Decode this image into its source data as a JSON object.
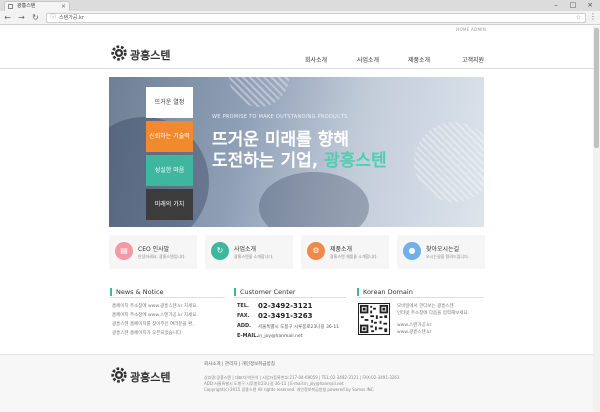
{
  "browser": {
    "tab_title": "광흥스텐",
    "close_glyph": "×",
    "url": "스텐가공.kr",
    "buttons": {
      "minimize": "–",
      "maximize": "□",
      "close": "×",
      "back": "←",
      "forward": "→",
      "reload": "↻",
      "menu": "⋮"
    }
  },
  "header": {
    "top_links": "HOME   ADMIN",
    "logo_text": "광흥스텐",
    "nav": [
      "회사소개",
      "사업소개",
      "제품소개",
      "고객지원"
    ]
  },
  "hero": {
    "subtitle": "WE PROMISE TO MAKE OUTSTANDING PRODUCTS",
    "line1": "뜨거운 미래를 향해",
    "line2_prefix": "도전하는 기업, ",
    "line2_highlight": "광흥스텐",
    "tabs": [
      {
        "label": "뜨거운 열정",
        "bg": "#ffffff",
        "fg": "#333333"
      },
      {
        "label": "신뢰하는 기술력",
        "bg": "#f08a2c",
        "fg": "#ffffff"
      },
      {
        "label": "성실한 마음",
        "bg": "#3fb69e",
        "fg": "#ffffff"
      },
      {
        "label": "미래의 가치",
        "bg": "#3c3c3c",
        "fg": "#ffffff"
      }
    ]
  },
  "features": [
    {
      "title": "CEO 인사말",
      "desc": "안녕하세요, 광흥스텐입니다.",
      "color": "#f29aa6",
      "icon_name": "document-icon",
      "glyph": "▤"
    },
    {
      "title": "사업소개",
      "desc": "광흥스텐을 소개합니다.",
      "color": "#3fb69e",
      "icon_name": "refresh-icon",
      "glyph": "↻"
    },
    {
      "title": "제품소개",
      "desc": "광흥스텐 제품을 소개합니다.",
      "color": "#f0894a",
      "icon_name": "gear-icon",
      "glyph": "⚙"
    },
    {
      "title": "찾아오시는길",
      "desc": "오시는길을 알려드립니다.",
      "color": "#6fb0e8",
      "icon_name": "location-pin-icon",
      "glyph": "●"
    }
  ],
  "news": {
    "title": "News & Notice",
    "items": [
      "홈페이지 주소창에 www.광흥스텐.kr 치세요.",
      "홈페이지 주소창에 www.스텐가공.kr 치세요.",
      "광흥스텐 홈페이지를 찾아주신 여러분을 환..",
      "광흥스텐 홈페이지가 오픈되었습니다."
    ]
  },
  "customer": {
    "title": "Customer Center",
    "rows": [
      {
        "label": "TEL.",
        "value": "02-3492-3121",
        "big": true
      },
      {
        "label": "FAX.",
        "value": "02-3491-3263",
        "big": true
      },
      {
        "label": "ADD.",
        "value": "서울특별시 도봉구 시루봉로23나길 36-11",
        "big": false
      },
      {
        "label": "E-MAIL.",
        "value": "in_joy@hanmail.net",
        "big": false
      }
    ]
  },
  "domain": {
    "title": "Korean Domain",
    "lines": [
      "모바일에서 한다보는 광흥스텐",
      "인터넷 주소창에 다음을 입력해보세요.",
      "",
      "www.스텐가공.kr",
      "www.광흥스텐.kr"
    ]
  },
  "footer": {
    "links": "회사소개 | 관리자 | 개인정보취급방침",
    "addr_lines": [
      "상호명:광흥스텐 | 대표자:박은석 | 사업자등록번호:217-04-69059 | TEL:02-3492-3121 | FAX:02-3491-3263",
      "ADD:서울특별시 도봉구 시루봉로23나길 36-11 | E-mail:in_joy@hanmail.net",
      "Copyright(c) 2015 광흥스텐 All rights reserved. 개인정보취급방침 powered by Somss INC."
    ]
  },
  "colors": {
    "accent": "#3fb69e",
    "highlight": "#4ecfb0"
  }
}
